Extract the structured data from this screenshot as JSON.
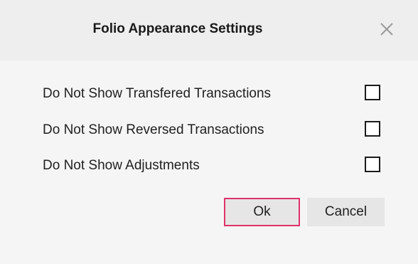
{
  "dialog": {
    "title": "Folio Appearance Settings",
    "close_icon": "close-icon"
  },
  "options": [
    {
      "label": "Do Not Show Transfered Transactions",
      "checked": false
    },
    {
      "label": "Do Not Show Reversed Transactions",
      "checked": false
    },
    {
      "label": "Do Not Show Adjustments",
      "checked": false
    }
  ],
  "buttons": {
    "ok_label": "Ok",
    "cancel_label": "Cancel"
  },
  "colors": {
    "ok_border": "#e0336b",
    "button_bg": "#e6e6e6",
    "dialog_bg": "#f5f5f5"
  }
}
